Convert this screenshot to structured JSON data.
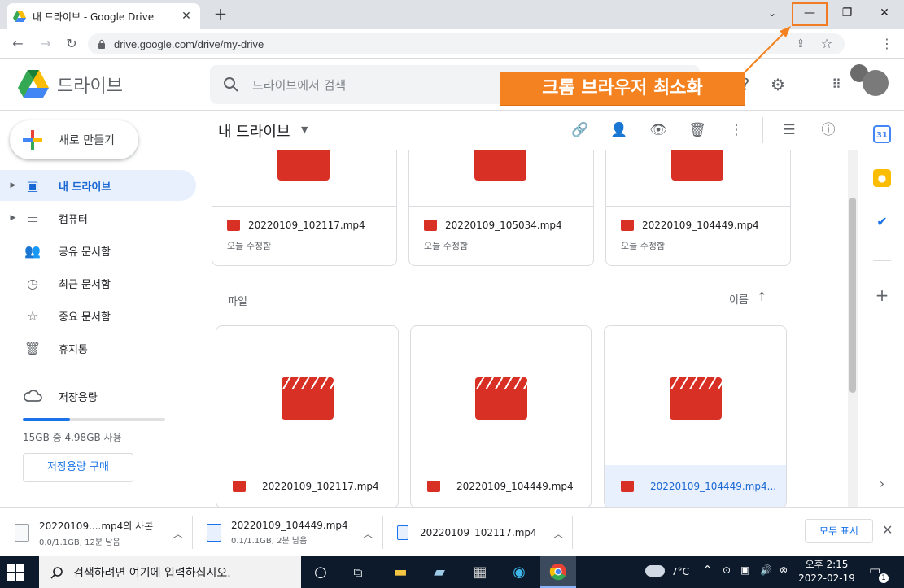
{
  "browser": {
    "tab_title": "내 드라이브 - Google Drive",
    "url": "drive.google.com/drive/my-drive"
  },
  "drive": {
    "product_name": "드라이브",
    "search_placeholder": "드라이브에서 검색",
    "new_button": "새로 만들기",
    "sidebar": [
      {
        "label": "내 드라이브",
        "icon": "my-drive-icon",
        "active": true
      },
      {
        "label": "컴퓨터",
        "icon": "computer-icon"
      },
      {
        "label": "공유 문서함",
        "icon": "shared-icon"
      },
      {
        "label": "최근 문서함",
        "icon": "clock-icon"
      },
      {
        "label": "중요 문서함",
        "icon": "star-icon"
      },
      {
        "label": "휴지통",
        "icon": "trash-icon"
      }
    ],
    "storage": {
      "label": "저장용량",
      "usage_text": "15GB 중 4.98GB 사용",
      "used_fraction": 0.33,
      "buy_button": "저장용량 구매"
    },
    "main_title": "내 드라이브",
    "section_label": "파일",
    "sort_label": "이름",
    "top_cards": [
      {
        "name": "20220109_102117.mp4",
        "modified": "오늘 수정함"
      },
      {
        "name": "20220109_105034.mp4",
        "modified": "오늘 수정함"
      },
      {
        "name": "20220109_104449.mp4",
        "modified": "오늘 수정함"
      }
    ],
    "files": [
      {
        "name": "20220109_102117.mp4"
      },
      {
        "name": "20220109_104449.mp4"
      },
      {
        "name": "20220109_104449.mp4...",
        "selected": true
      }
    ]
  },
  "annotation": {
    "callout": "크롬 브라우저 최소화",
    "color": "#f58220"
  },
  "downloads": {
    "items": [
      {
        "name": "20220109....mp4의 사본",
        "status": "0.0/1.1GB, 12분 남음"
      },
      {
        "name": "20220109_104449.mp4",
        "status": "0.1/1.1GB, 2분 남음"
      },
      {
        "name": "20220109_102117.mp4",
        "status": ""
      }
    ],
    "show_all": "모두 표시"
  },
  "taskbar": {
    "search_text": "검색하려면 여기에 입력하십시오.",
    "temperature": "7°C",
    "time": "오후 2:15",
    "date": "2022-02-19",
    "notification_count": "1"
  }
}
